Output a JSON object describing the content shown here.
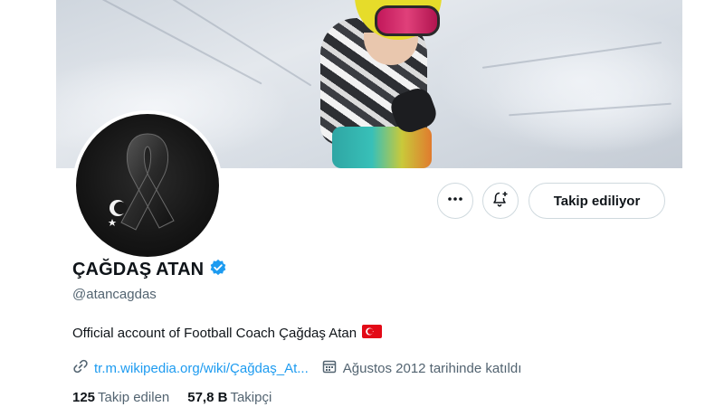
{
  "profile": {
    "display_name": "ÇAĞDAŞ ATAN",
    "verified_icon": "verified-badge-icon",
    "handle": "@atancagdas",
    "bio": "Official account of Football Coach Çağdaş Atan",
    "bio_flag_icon": "turkey-flag-icon",
    "website": "tr.m.wikipedia.org/wiki/Çağdaş_At...",
    "joined": "Ağustos 2012 tarihinde katıldı"
  },
  "actions": {
    "more_icon": "more-dots-icon",
    "notify_icon": "bell-plus-icon",
    "following_label": "Takip ediliyor"
  },
  "stats": {
    "following_count": "125",
    "following_label": "Takip edilen",
    "followers_count": "57,8 B",
    "followers_label": "Takipçi"
  },
  "colors": {
    "accent": "#1d9bf0",
    "text_primary": "#0f1419",
    "text_secondary": "#536471",
    "border": "#cfd9de"
  }
}
